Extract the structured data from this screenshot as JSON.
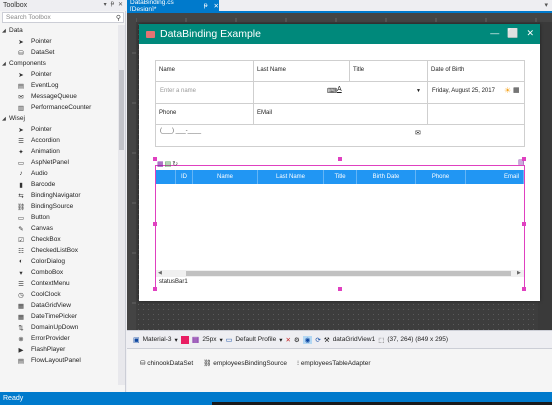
{
  "toolbox": {
    "title": "Toolbox",
    "controls": [
      "▾",
      "ᵽ",
      "✕"
    ],
    "search_placeholder": "Search Toolbox",
    "categories": [
      {
        "name": "Data",
        "items": [
          {
            "label": "Pointer",
            "icon": "pointer-icon"
          },
          {
            "label": "DataSet",
            "icon": "dataset-icon"
          }
        ]
      },
      {
        "name": "Components",
        "items": [
          {
            "label": "Pointer",
            "icon": "pointer-icon"
          },
          {
            "label": "EventLog",
            "icon": "eventlog-icon"
          },
          {
            "label": "MessageQueue",
            "icon": "messagequeue-icon"
          },
          {
            "label": "PerformanceCounter",
            "icon": "perfcounter-icon"
          }
        ]
      },
      {
        "name": "Wisej",
        "items": [
          {
            "label": "Pointer",
            "icon": "pointer-icon"
          },
          {
            "label": "Accordion",
            "icon": "accordion-icon"
          },
          {
            "label": "Animation",
            "icon": "animation-icon"
          },
          {
            "label": "AspNetPanel",
            "icon": "aspnetpanel-icon"
          },
          {
            "label": "Audio",
            "icon": "audio-icon"
          },
          {
            "label": "Barcode",
            "icon": "barcode-icon"
          },
          {
            "label": "BindingNavigator",
            "icon": "bindingnavigator-icon"
          },
          {
            "label": "BindingSource",
            "icon": "bindingsource-icon"
          },
          {
            "label": "Button",
            "icon": "button-icon"
          },
          {
            "label": "Canvas",
            "icon": "canvas-icon"
          },
          {
            "label": "CheckBox",
            "icon": "checkbox-icon"
          },
          {
            "label": "CheckedListBox",
            "icon": "checkedlistbox-icon"
          },
          {
            "label": "ColorDialog",
            "icon": "colordialog-icon"
          },
          {
            "label": "ComboBox",
            "icon": "combobox-icon"
          },
          {
            "label": "ContextMenu",
            "icon": "contextmenu-icon"
          },
          {
            "label": "CoolClock",
            "icon": "coolclock-icon"
          },
          {
            "label": "DataGridView",
            "icon": "datagridview-icon"
          },
          {
            "label": "DateTimePicker",
            "icon": "datetimepicker-icon"
          },
          {
            "label": "DomainUpDown",
            "icon": "domainupdown-icon"
          },
          {
            "label": "ErrorProvider",
            "icon": "errorprovider-icon"
          },
          {
            "label": "FlashPlayer",
            "icon": "flashplayer-icon"
          },
          {
            "label": "FlowLayoutPanel",
            "icon": "flowlayoutpanel-icon"
          }
        ]
      }
    ]
  },
  "tab": {
    "label": "DataBinding.cs [Design]*",
    "pin": "ᵽ",
    "close": "✕"
  },
  "form": {
    "title": "DataBinding Example",
    "window_controls": [
      "—",
      "⬜",
      "✕"
    ],
    "fields": {
      "name_label": "Name",
      "lastname_label": "Last Name",
      "title_label": "Title",
      "dob_label": "Date of Birth",
      "name_placeholder": "Enter a name",
      "dob_value": "Friday, August 25, 2017",
      "phone_label": "Phone",
      "email_label": "EMail",
      "phone_mask": "(___) ___-____"
    },
    "grid": {
      "columns": [
        "ID",
        "Name",
        "Last Name",
        "Title",
        "Birth Date",
        "Phone",
        "Email"
      ],
      "status": "statusBar1"
    }
  },
  "toolbar": {
    "theme": "Material-3",
    "grid_size": "25px",
    "profile": "Default Profile",
    "selected": "dataGridView1",
    "position": "(37, 264) (849 x 295)"
  },
  "tray": [
    "chinookDataSet",
    "employeesBindingSource",
    "employeesTableAdapter"
  ],
  "status": "Ready"
}
